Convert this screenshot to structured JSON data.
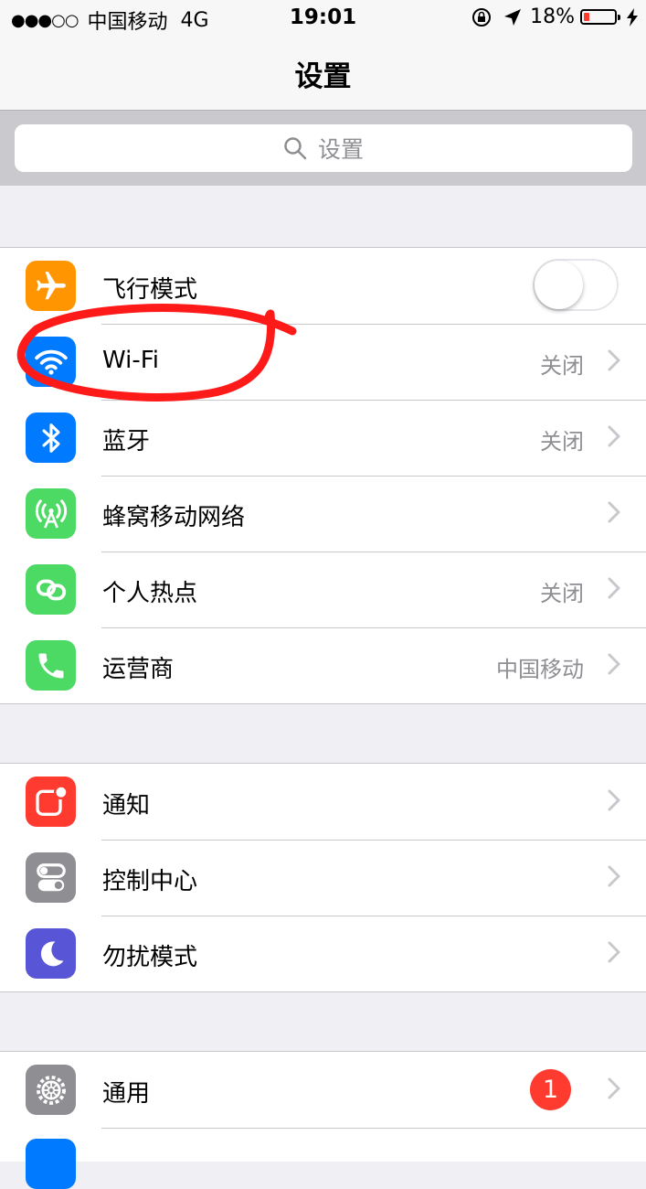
{
  "status_bar": {
    "signal": "●●●○○",
    "carrier": "中国移动",
    "network": "4G",
    "time": "19:01",
    "battery_percent": "18%",
    "battery_level": 0.18
  },
  "nav": {
    "title": "设置"
  },
  "search": {
    "placeholder": "设置"
  },
  "groups": [
    {
      "rows": [
        {
          "label": "飞行模式",
          "control": "toggle",
          "toggle_on": false,
          "icon": "airplane-icon",
          "icon_color": "#ff9500"
        },
        {
          "label": "Wi-Fi",
          "value": "关闭",
          "icon": "wifi-icon",
          "icon_color": "#007aff"
        },
        {
          "label": "蓝牙",
          "value": "关闭",
          "icon": "bluetooth-icon",
          "icon_color": "#007aff"
        },
        {
          "label": "蜂窝移动网络",
          "value": "",
          "icon": "cellular-icon",
          "icon_color": "#4cd964"
        },
        {
          "label": "个人热点",
          "value": "关闭",
          "icon": "hotspot-icon",
          "icon_color": "#4cd964"
        },
        {
          "label": "运营商",
          "value": "中国移动",
          "icon": "phone-icon",
          "icon_color": "#4cd964"
        }
      ]
    },
    {
      "rows": [
        {
          "label": "通知",
          "icon": "notifications-icon",
          "icon_color": "#ff3b30"
        },
        {
          "label": "控制中心",
          "icon": "control-center-icon",
          "icon_color": "#8e8e93"
        },
        {
          "label": "勿扰模式",
          "icon": "moon-icon",
          "icon_color": "#5856d6"
        }
      ]
    },
    {
      "rows": [
        {
          "label": "通用",
          "badge": "1",
          "icon": "gear-icon",
          "icon_color": "#8e8e93"
        }
      ]
    }
  ],
  "annotation": {
    "color": "#ff1a1a",
    "target": "Wi-Fi"
  }
}
